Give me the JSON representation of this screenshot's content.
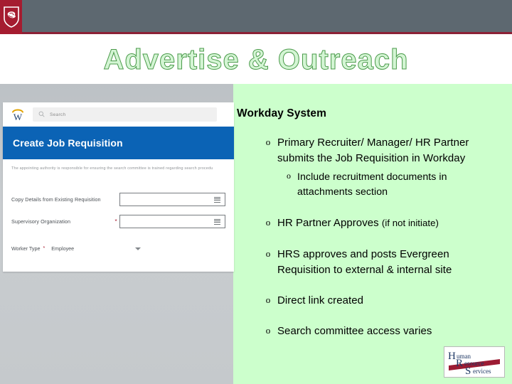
{
  "slide": {
    "title": "Advertise & Outreach",
    "title_color": "#ccffcc",
    "title_outline_color": "#4a9a4a",
    "header_bar_color": "#5d6870",
    "header_rule_color": "#8c2136",
    "logo_block_color": "#a51c30",
    "panel_color": "#ccffcc",
    "gray_color": "#c7cbce"
  },
  "brand": {
    "institution_logo": "wsu-cougar-shield-icon"
  },
  "workday_screenshot": {
    "app_logo": "workday-w-logo-icon",
    "search": {
      "icon": "search-icon",
      "placeholder": "Search",
      "value": ""
    },
    "page_banner": "Create Job Requisition",
    "banner_color": "#0b63b5",
    "note": "The appointing authority is responsible for ensuring the search committee is trained regarding search procedu",
    "fields": [
      {
        "label": "Copy Details from Existing Requisition",
        "required": false,
        "required_marker": "",
        "value": "",
        "menu_icon": "list-menu-icon"
      },
      {
        "label": "Supervisory Organization",
        "required": true,
        "required_marker": "*",
        "value": "",
        "menu_icon": "list-menu-icon"
      }
    ],
    "worker_type": {
      "label": "Worker Type",
      "required_marker": "*",
      "value": "Employee",
      "caret_icon": "chevron-down-icon"
    }
  },
  "content": {
    "heading": "Workday System",
    "bullets": [
      {
        "marker": "o",
        "level": 1,
        "text": "Primary Recruiter/ Manager/ HR Partner submits the Job Requisition in Workday"
      },
      {
        "marker": "o",
        "level": 2,
        "text": "Include recruitment documents in attachments section"
      },
      {
        "marker": "o",
        "level": 1,
        "text": "HR Partner Approves ",
        "text_small": "(if not initiate)"
      },
      {
        "marker": "o",
        "level": 1,
        "text": "HRS approves and posts Evergreen Requisition to external & internal site"
      },
      {
        "marker": "o",
        "level": 1,
        "text": "Direct link created"
      },
      {
        "marker": "o",
        "level": 1,
        "text": "Search committee access varies"
      }
    ]
  },
  "hrs_logo": {
    "name": "hrs-logo",
    "line1_cap": "H",
    "line1_rest": "uman",
    "line2_cap": "R",
    "line2_rest": "esource",
    "line3_cap": "S",
    "line3_rest": "ervices",
    "text_color": "#1f3864",
    "band_color": "#9c1b33"
  }
}
